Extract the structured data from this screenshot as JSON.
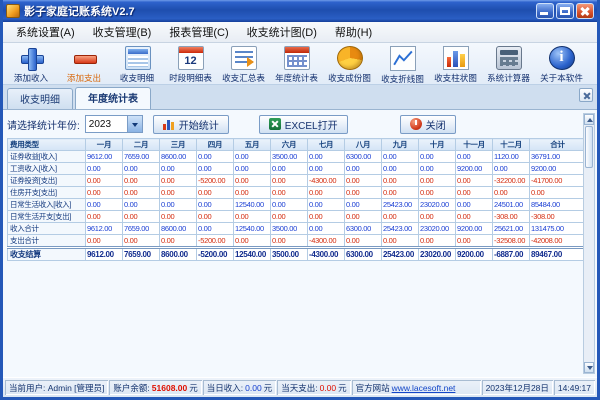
{
  "window": {
    "title": "影子家庭记账系统V2.7"
  },
  "menu": {
    "items": [
      {
        "label": "系统设置(A)"
      },
      {
        "label": "收支管理(B)"
      },
      {
        "label": "报表管理(C)"
      },
      {
        "label": "收支统计图(D)"
      },
      {
        "label": "帮助(H)"
      }
    ]
  },
  "toolbar": {
    "buttons": [
      {
        "label": "添加收入",
        "icon": "add-income"
      },
      {
        "label": "添加支出",
        "icon": "add-expense"
      },
      {
        "label": "收支明细",
        "icon": "detail-list"
      },
      {
        "label": "时段明细表",
        "icon": "calendar-12",
        "icon_text": "12"
      },
      {
        "label": "收支汇总表",
        "icon": "summary-report"
      },
      {
        "label": "年度统计表",
        "icon": "year-table"
      },
      {
        "label": "收支成份图",
        "icon": "pie-chart"
      },
      {
        "label": "收支折线图",
        "icon": "line-chart"
      },
      {
        "label": "收支柱状图",
        "icon": "bar-chart"
      },
      {
        "label": "系统计算器",
        "icon": "calculator"
      },
      {
        "label": "关于本软件",
        "icon": "about-info"
      }
    ]
  },
  "tabs": {
    "items": [
      {
        "label": "收支明细",
        "active": false
      },
      {
        "label": "年度统计表",
        "active": true
      }
    ]
  },
  "controls": {
    "year_label": "请选择统计年份:",
    "year_value": "2023",
    "start_label": "开始统计",
    "excel_label": "EXCEL打开",
    "close_label": "关闭"
  },
  "chart_data": {
    "type": "table",
    "title": "年度统计表 2023",
    "columns": [
      "费用类型",
      "一月",
      "二月",
      "三月",
      "四月",
      "五月",
      "六月",
      "七月",
      "八月",
      "九月",
      "十月",
      "十一月",
      "十二月",
      "合计"
    ],
    "rows": [
      {
        "label": "证券收益[收入]",
        "kind": "income",
        "values": [
          "9612.00",
          "7659.00",
          "8600.00",
          "0.00",
          "0.00",
          "3500.00",
          "0.00",
          "6300.00",
          "0.00",
          "0.00",
          "0.00",
          "1120.00",
          "36791.00"
        ]
      },
      {
        "label": "工资收入[收入]",
        "kind": "income",
        "values": [
          "0.00",
          "0.00",
          "0.00",
          "0.00",
          "0.00",
          "0.00",
          "0.00",
          "0.00",
          "0.00",
          "0.00",
          "9200.00",
          "0.00",
          "9200.00"
        ]
      },
      {
        "label": "证券投资[支出]",
        "kind": "expense",
        "values": [
          "0.00",
          "0.00",
          "0.00",
          "-5200.00",
          "0.00",
          "0.00",
          "-4300.00",
          "0.00",
          "0.00",
          "0.00",
          "0.00",
          "-32200.00",
          "-41700.00"
        ]
      },
      {
        "label": "住房开支[支出]",
        "kind": "expense",
        "values": [
          "0.00",
          "0.00",
          "0.00",
          "0.00",
          "0.00",
          "0.00",
          "0.00",
          "0.00",
          "0.00",
          "0.00",
          "0.00",
          "0.00",
          "0.00"
        ]
      },
      {
        "label": "日常生活收入[收入]",
        "kind": "income",
        "values": [
          "0.00",
          "0.00",
          "0.00",
          "0.00",
          "12540.00",
          "0.00",
          "0.00",
          "0.00",
          "25423.00",
          "23020.00",
          "0.00",
          "24501.00",
          "85484.00"
        ]
      },
      {
        "label": "日常生活开支[支出]",
        "kind": "expense",
        "values": [
          "0.00",
          "0.00",
          "0.00",
          "0.00",
          "0.00",
          "0.00",
          "0.00",
          "0.00",
          "0.00",
          "0.00",
          "0.00",
          "-308.00",
          "-308.00"
        ]
      },
      {
        "label": "收入合计",
        "kind": "income-total",
        "values": [
          "9612.00",
          "7659.00",
          "8600.00",
          "0.00",
          "12540.00",
          "3500.00",
          "0.00",
          "6300.00",
          "25423.00",
          "23020.00",
          "9200.00",
          "25621.00",
          "131475.00"
        ]
      },
      {
        "label": "支出合计",
        "kind": "expense-total",
        "values": [
          "0.00",
          "0.00",
          "0.00",
          "-5200.00",
          "0.00",
          "0.00",
          "-4300.00",
          "0.00",
          "0.00",
          "0.00",
          "0.00",
          "-32508.00",
          "-42008.00"
        ]
      },
      {
        "label": "收支结算",
        "kind": "net",
        "values": [
          "9612.00",
          "7659.00",
          "8600.00",
          "-5200.00",
          "12540.00",
          "3500.00",
          "-4300.00",
          "6300.00",
          "25423.00",
          "23020.00",
          "9200.00",
          "-6887.00",
          "89467.00"
        ]
      }
    ]
  },
  "statusbar": {
    "user": "当前用户: Admin [管理员]",
    "balance_label": "账户余额:",
    "balance_value": "51608.00",
    "balance_unit": "元",
    "income_label": "当日收入:",
    "income_value": "0.00",
    "income_unit": "元",
    "expense_label": "当天支出:",
    "expense_value": "0.00",
    "expense_unit": "元",
    "site_label": "官方网站",
    "site_url": "www.lacesoft.net",
    "date": "2023年12月28日",
    "time": "14:49:17"
  },
  "colors": {
    "income": "#1b3fd4",
    "expense": "#d42d10",
    "net": "#122c8e",
    "titlebar": "#2a5ec4",
    "balance": "#e01000"
  }
}
